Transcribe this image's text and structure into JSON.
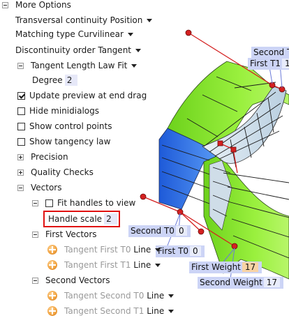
{
  "tree": {
    "more_options": "More Options",
    "transversal_continuity": "Transversal continuity Position",
    "matching_type": "Matching type Curvilinear",
    "discontinuity_order": "Discontinuity order Tangent",
    "tangent_length_law": "Tangent Length Law Fit",
    "degree_label": "Degree",
    "degree_value": "2",
    "update_preview": "Update preview at end drag",
    "hide_minidialogs": "Hide minidialogs",
    "show_control_points": "Show control points",
    "show_tangency_law": "Show tangency law",
    "precision": "Precision",
    "quality_checks": "Quality Checks",
    "vectors": "Vectors",
    "fit_handles": "Fit handles to view",
    "handle_scale_label": "Handle scale",
    "handle_scale_value": "2",
    "first_vectors": "First Vectors",
    "tangent_first_t0_label": "Tangent First T0",
    "tangent_first_t0_value": "Line",
    "tangent_first_t1_label": "Tangent First T1",
    "tangent_first_t1_value": "Line",
    "second_vectors": "Second Vectors",
    "tangent_second_t0_label": "Tangent Second T0",
    "tangent_second_t0_value": "Line",
    "tangent_second_t1_label": "Tangent Second T1",
    "tangent_second_t1_value": "Line"
  },
  "viewport": {
    "second_t1_label": "Second T1",
    "first_t1_label": "First T1",
    "first_t1_value": "1",
    "second_t0_label": "Second T0",
    "second_t0_value": "0",
    "first_t0_label": "First T0",
    "first_t0_value": "0",
    "first_weight_label": "First Weight",
    "first_weight_value": "17",
    "second_weight_label": "Second Weight",
    "second_weight_value": "17"
  },
  "colors": {
    "highlight": "#e01010",
    "green_surface": "#7fe02a",
    "blue_surface": "#2f6fe6",
    "handle_line": "#d42020"
  }
}
